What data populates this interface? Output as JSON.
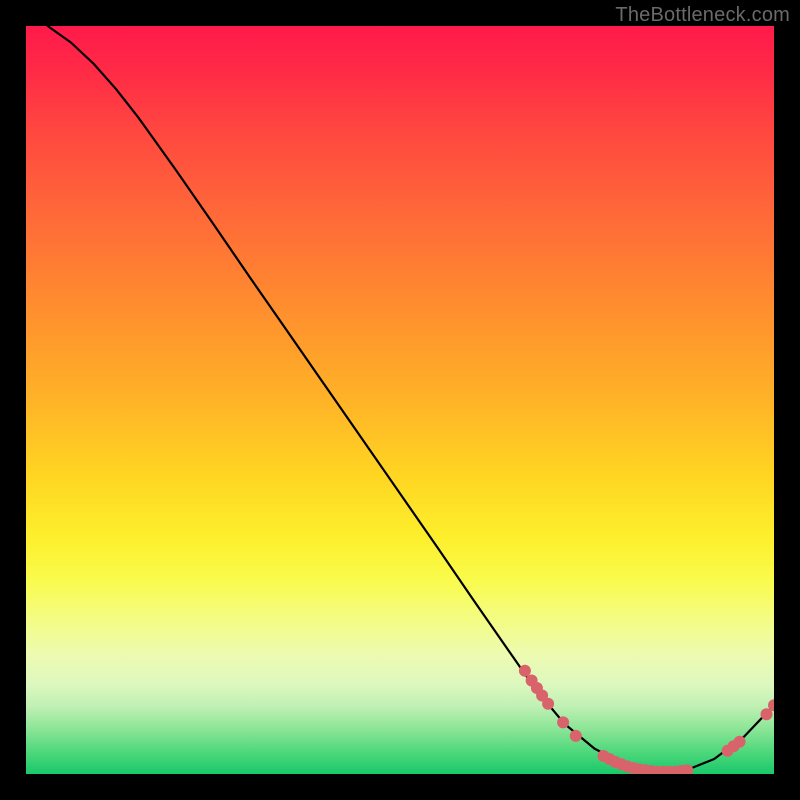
{
  "watermark": "TheBottleneck.com",
  "chart_data": {
    "type": "line",
    "title": "",
    "xlabel": "",
    "ylabel": "",
    "xlim": [
      0,
      100
    ],
    "ylim": [
      0,
      100
    ],
    "grid": false,
    "curve": {
      "name": "bottleneck-curve",
      "color": "#000000",
      "points": [
        {
          "x": 2.9,
          "y": 100.0
        },
        {
          "x": 6.0,
          "y": 97.8
        },
        {
          "x": 9.0,
          "y": 95.0
        },
        {
          "x": 12.0,
          "y": 91.6
        },
        {
          "x": 15.0,
          "y": 87.8
        },
        {
          "x": 20.0,
          "y": 80.8
        },
        {
          "x": 25.0,
          "y": 73.6
        },
        {
          "x": 30.0,
          "y": 66.3
        },
        {
          "x": 35.0,
          "y": 59.1
        },
        {
          "x": 40.0,
          "y": 51.9
        },
        {
          "x": 45.0,
          "y": 44.7
        },
        {
          "x": 50.0,
          "y": 37.5
        },
        {
          "x": 55.0,
          "y": 30.3
        },
        {
          "x": 60.0,
          "y": 23.0
        },
        {
          "x": 65.0,
          "y": 15.8
        },
        {
          "x": 68.0,
          "y": 11.5
        },
        {
          "x": 72.0,
          "y": 6.7
        },
        {
          "x": 76.0,
          "y": 3.4
        },
        {
          "x": 80.0,
          "y": 1.3
        },
        {
          "x": 84.0,
          "y": 0.3
        },
        {
          "x": 88.0,
          "y": 0.4
        },
        {
          "x": 92.0,
          "y": 2.0
        },
        {
          "x": 96.0,
          "y": 5.0
        },
        {
          "x": 100.0,
          "y": 9.2
        }
      ]
    },
    "markers": {
      "name": "data-points",
      "color": "#d9636a",
      "radius": 6,
      "points": [
        {
          "x": 66.7,
          "y": 13.8
        },
        {
          "x": 67.6,
          "y": 12.5
        },
        {
          "x": 68.3,
          "y": 11.5
        },
        {
          "x": 69.0,
          "y": 10.5
        },
        {
          "x": 69.8,
          "y": 9.4
        },
        {
          "x": 71.8,
          "y": 6.9
        },
        {
          "x": 73.5,
          "y": 5.1
        },
        {
          "x": 77.2,
          "y": 2.4
        },
        {
          "x": 78.0,
          "y": 2.0
        },
        {
          "x": 78.8,
          "y": 1.6
        },
        {
          "x": 79.6,
          "y": 1.3
        },
        {
          "x": 80.4,
          "y": 1.0
        },
        {
          "x": 81.2,
          "y": 0.8
        },
        {
          "x": 82.0,
          "y": 0.6
        },
        {
          "x": 82.8,
          "y": 0.5
        },
        {
          "x": 83.6,
          "y": 0.4
        },
        {
          "x": 84.4,
          "y": 0.3
        },
        {
          "x": 85.2,
          "y": 0.3
        },
        {
          "x": 86.0,
          "y": 0.3
        },
        {
          "x": 86.8,
          "y": 0.3
        },
        {
          "x": 87.6,
          "y": 0.4
        },
        {
          "x": 88.4,
          "y": 0.5
        },
        {
          "x": 93.8,
          "y": 3.1
        },
        {
          "x": 94.6,
          "y": 3.7
        },
        {
          "x": 95.4,
          "y": 4.3
        },
        {
          "x": 99.0,
          "y": 8.0
        },
        {
          "x": 100.0,
          "y": 9.2
        }
      ]
    }
  }
}
